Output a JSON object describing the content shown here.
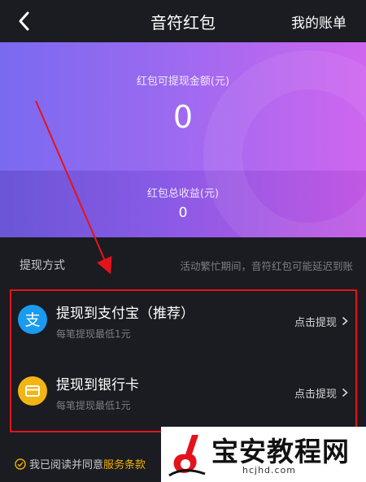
{
  "header": {
    "back_icon": "chevron-left-icon",
    "title": "音符红包",
    "bill_link": "我的账单"
  },
  "banner": {
    "available_label": "红包可提现金额(元)",
    "available_amount": "0",
    "total_label": "红包总收益(元)",
    "total_amount": "0"
  },
  "withdraw": {
    "method_label": "提现方式",
    "busy_note": "活动繁忙期间，音符红包可能延迟到账",
    "options": [
      {
        "icon": "alipay-icon",
        "title": "提现到支付宝（推荐）",
        "subtitle": "每笔提现最低1元",
        "action": "点击提现",
        "color": "#1a9bf0"
      },
      {
        "icon": "bank-card-icon",
        "title": "提现到银行卡",
        "subtitle": "每笔提现最低1元",
        "action": "点击提现",
        "color": "#f3b514"
      }
    ]
  },
  "agreement": {
    "text": "我已阅读并同意",
    "link": "服务条款"
  },
  "watermark": {
    "text": "宝安教程网",
    "domain": "hcjhd.com"
  },
  "colors": {
    "background": "#1b1c21",
    "highlight": "#e4131b",
    "accent": "#f3b000"
  }
}
